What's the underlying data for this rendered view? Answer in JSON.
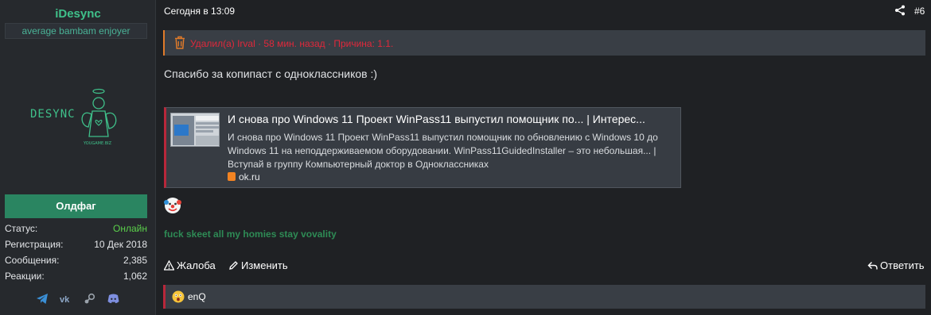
{
  "user": {
    "name": "iDesync",
    "title": "average bambam enjoyer",
    "avatar_text": "DESYNC",
    "avatar_subtext": "YOUGAME.BIZ",
    "rank": "Олдфаг",
    "stats": [
      {
        "label": "Статус:",
        "value": "Онлайн"
      },
      {
        "label": "Регистрация:",
        "value": "10 Дек 2018"
      },
      {
        "label": "Сообщения:",
        "value": "2,385"
      },
      {
        "label": "Реакции:",
        "value": "1,062"
      }
    ],
    "socials": [
      "telegram-icon",
      "vk-icon",
      "steam-icon",
      "discord-icon"
    ]
  },
  "post": {
    "date": "Сегодня в 13:09",
    "number": "#6",
    "deleted_notice": "Удалил(а) Irval · 58 мин. назад · Причина: 1.1.",
    "text": "Спасибо за копипаст с одноклассников :)",
    "unfurl": {
      "title": "И снова про Windows 11 Проект WinPass11 выпустил помощник по... | Интерес...",
      "description": "И снова про Windows 11 Проект WinPass11 выпустил помощник по обновлению с Windows 10 до Windows 11 на неподдерживаемом оборудовании. WinPass11GuidedInstaller – это небольшая... | Вступай в группу Компьютерный доктор в Одноклассниках",
      "domain": "ok.ru"
    },
    "signature": "fuck skeet all my homies stay vovality",
    "actions": {
      "report": "Жалоба",
      "edit": "Изменить",
      "reply": "Ответить"
    },
    "reactions": {
      "users": "enQ"
    }
  },
  "colors": {
    "accent_green": "#3fc08a",
    "rank_bg": "#2a8561",
    "online": "#5bd14b",
    "deleted_red": "#e0283b",
    "deleted_border": "#e07b2a",
    "unfurl_border": "#b8273a"
  }
}
